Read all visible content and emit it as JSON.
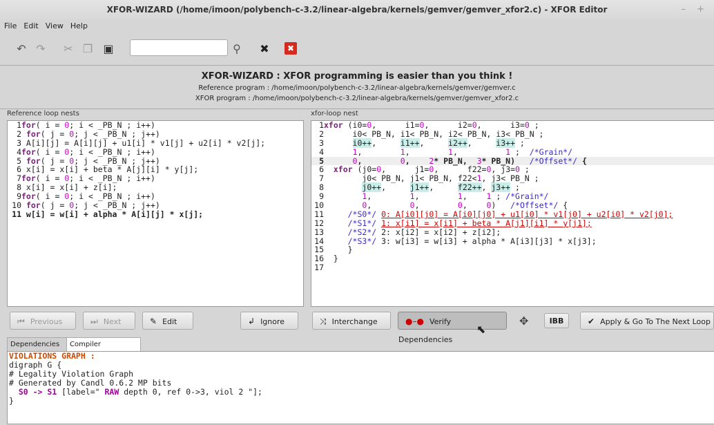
{
  "window": {
    "title": "XFOR-WIZARD (/home/imoon/polybench-c-3.2/linear-algebra/kernels/gemver/gemver_xfor2.c) - XFOR Editor",
    "controls": "– +"
  },
  "menu": [
    "File",
    "Edit",
    "View",
    "Help"
  ],
  "toolbar": {
    "undo_icon": "undo-icon",
    "redo_icon": "redo-icon",
    "cut_icon": "cut-icon",
    "copy_icon": "copy-icon",
    "paste_icon": "paste-icon",
    "search_value": "",
    "find_icon": "magnifier-icon",
    "clear_icon": "close-icon",
    "stop_icon": "stop-icon"
  },
  "banner": {
    "headline": "XFOR-WIZARD : XFOR programming is easier than you think !",
    "reference": "Reference program : /home/imoon/polybench-c-3.2/linear-algebra/kernels/gemver/gemver.c",
    "xfor": "XFOR program : /home/imoon/polybench-c-3.2/linear-algebra/kernels/gemver/gemver_xfor2.c"
  },
  "left_panel": {
    "label": "Reference loop nests",
    "lines": [
      {
        "n": "1",
        "segs": [
          {
            "t": "for",
            "c": "kw"
          },
          {
            "t": "( i = "
          },
          {
            "t": "0",
            "c": "num"
          },
          {
            "t": "; i < _PB_N ; i++)"
          }
        ]
      },
      {
        "n": "2",
        "segs": [
          {
            "t": " "
          },
          {
            "t": "for",
            "c": "kw"
          },
          {
            "t": "( j = "
          },
          {
            "t": "0",
            "c": "num"
          },
          {
            "t": "; j < _PB_N ; j++)"
          }
        ]
      },
      {
        "n": "3",
        "segs": [
          {
            "t": " A[i][j] = A[i][j] + u1[i] * v1[j] + u2[i] * v2[j];"
          }
        ]
      },
      {
        "n": "4",
        "segs": [
          {
            "t": "for",
            "c": "kw"
          },
          {
            "t": "( i = "
          },
          {
            "t": "0",
            "c": "num"
          },
          {
            "t": "; i < _PB_N ; i++)"
          }
        ]
      },
      {
        "n": "5",
        "segs": [
          {
            "t": " "
          },
          {
            "t": "for",
            "c": "kw"
          },
          {
            "t": "( j = "
          },
          {
            "t": "0",
            "c": "num"
          },
          {
            "t": "; j < _PB_N ; j++)"
          }
        ]
      },
      {
        "n": "6",
        "segs": [
          {
            "t": " x[i] = x[i] + beta * A[j][i] * y[j];"
          }
        ]
      },
      {
        "n": "7",
        "segs": [
          {
            "t": "for",
            "c": "kw"
          },
          {
            "t": "( i = "
          },
          {
            "t": "0",
            "c": "num"
          },
          {
            "t": "; i < _PB_N ; i++)"
          }
        ]
      },
      {
        "n": "8",
        "segs": [
          {
            "t": " x[i] = x[i] + z[i];"
          }
        ]
      },
      {
        "n": "9",
        "segs": [
          {
            "t": "for",
            "c": "kw"
          },
          {
            "t": "( i = "
          },
          {
            "t": "0",
            "c": "num"
          },
          {
            "t": "; i < _PB_N ; i++)"
          }
        ]
      },
      {
        "n": "10",
        "segs": [
          {
            "t": " "
          },
          {
            "t": "for",
            "c": "kw"
          },
          {
            "t": "( j = "
          },
          {
            "t": "0",
            "c": "num"
          },
          {
            "t": "; j < _PB_N ; j++)"
          }
        ]
      },
      {
        "n": "11",
        "bold": true,
        "segs": [
          {
            "t": " w[i] = w[i] + alpha * A[i][j] * x[j];"
          }
        ]
      }
    ]
  },
  "right_panel": {
    "label": "xfor-loop nest",
    "lines": [
      {
        "n": "1",
        "segs": [
          {
            "t": "xfor",
            "c": "kw"
          },
          {
            "t": " (i0="
          },
          {
            "t": "0",
            "c": "num"
          },
          {
            "t": ",      i1="
          },
          {
            "t": "0",
            "c": "num"
          },
          {
            "t": ",      i2="
          },
          {
            "t": "0",
            "c": "num"
          },
          {
            "t": ",      i3="
          },
          {
            "t": "0",
            "c": "num"
          },
          {
            "t": " ;"
          }
        ]
      },
      {
        "n": "2",
        "segs": [
          {
            "t": "      i0< PB_N, i1< PB_N, i2< PB_N, i3< PB_N ;"
          }
        ]
      },
      {
        "n": "3",
        "segs": [
          {
            "t": "      "
          },
          {
            "t": "i0++",
            "c": "hl"
          },
          {
            "t": ",     "
          },
          {
            "t": "i1++",
            "c": "hl"
          },
          {
            "t": ",     "
          },
          {
            "t": "i2++",
            "c": "hl"
          },
          {
            "t": ",     "
          },
          {
            "t": "i3++",
            "c": "hl"
          },
          {
            "t": " ;"
          }
        ]
      },
      {
        "n": "4",
        "segs": [
          {
            "t": "      "
          },
          {
            "t": "1",
            "c": "num"
          },
          {
            "t": ",        "
          },
          {
            "t": "1",
            "c": "num"
          },
          {
            "t": ",        "
          },
          {
            "t": "1",
            "c": "num"
          },
          {
            "t": ",          "
          },
          {
            "t": "1",
            "c": "num"
          },
          {
            "t": " ;  "
          },
          {
            "t": "/*Grain*/",
            "c": "cmt"
          }
        ]
      },
      {
        "n": "5",
        "bold": true,
        "cur": true,
        "segs": [
          {
            "t": "      "
          },
          {
            "t": "0",
            "c": "num"
          },
          {
            "t": ",        "
          },
          {
            "t": "0",
            "c": "num"
          },
          {
            "t": ",    "
          },
          {
            "t": "2",
            "c": "num"
          },
          {
            "t": "* PB_N,  "
          },
          {
            "t": "3",
            "c": "num"
          },
          {
            "t": "* PB_N)   "
          },
          {
            "t": "/*Offset*/",
            "c": "cmt"
          },
          {
            "t": " {"
          }
        ]
      },
      {
        "n": "6",
        "segs": [
          {
            "t": "  "
          },
          {
            "t": "xfor",
            "c": "kw"
          },
          {
            "t": " (j0="
          },
          {
            "t": "0",
            "c": "num"
          },
          {
            "t": ",      j1="
          },
          {
            "t": "0",
            "c": "num"
          },
          {
            "t": ",      f22="
          },
          {
            "t": "0",
            "c": "num"
          },
          {
            "t": ", j3="
          },
          {
            "t": "0",
            "c": "num"
          },
          {
            "t": " ;"
          }
        ]
      },
      {
        "n": "7",
        "segs": [
          {
            "t": "        j0< PB_N, j1< PB_N, f22<"
          },
          {
            "t": "1",
            "c": "num"
          },
          {
            "t": ", j3< PB_N ;"
          }
        ]
      },
      {
        "n": "8",
        "segs": [
          {
            "t": "        "
          },
          {
            "t": "j0++",
            "c": "hl"
          },
          {
            "t": ",     "
          },
          {
            "t": "j1++",
            "c": "hl"
          },
          {
            "t": ",     "
          },
          {
            "t": "f22++",
            "c": "hl"
          },
          {
            "t": ", "
          },
          {
            "t": "j3++",
            "c": "hl"
          },
          {
            "t": " ;"
          }
        ]
      },
      {
        "n": "9",
        "segs": [
          {
            "t": "        "
          },
          {
            "t": "1",
            "c": "num"
          },
          {
            "t": ",        "
          },
          {
            "t": "1",
            "c": "num"
          },
          {
            "t": ",        "
          },
          {
            "t": "1",
            "c": "num"
          },
          {
            "t": ",    "
          },
          {
            "t": "1",
            "c": "num"
          },
          {
            "t": " ; "
          },
          {
            "t": "/*Grain*/",
            "c": "cmt"
          }
        ]
      },
      {
        "n": "10",
        "segs": [
          {
            "t": "        "
          },
          {
            "t": "0",
            "c": "num"
          },
          {
            "t": ",        "
          },
          {
            "t": "0",
            "c": "num"
          },
          {
            "t": ",        "
          },
          {
            "t": "0",
            "c": "num"
          },
          {
            "t": ",    "
          },
          {
            "t": "0",
            "c": "num"
          },
          {
            "t": ")   "
          },
          {
            "t": "/*Offset*/",
            "c": "cmt"
          },
          {
            "t": " {"
          }
        ]
      },
      {
        "n": "11",
        "segs": [
          {
            "t": "     "
          },
          {
            "t": "/*S0*/",
            "c": "cmt"
          },
          {
            "t": " "
          },
          {
            "t": "0: A[i0][j0] = A[i0][j0] + u1[i0] * v1[j0] + u2[i0] * v2[j0];",
            "c": "redul"
          }
        ]
      },
      {
        "n": "12",
        "segs": [
          {
            "t": "     "
          },
          {
            "t": "/*S1*/",
            "c": "cmt"
          },
          {
            "t": " "
          },
          {
            "t": "1: x[i1] = x[i1] + beta * A[j1][i1] * y[j1];",
            "c": "redul"
          }
        ]
      },
      {
        "n": "13",
        "segs": [
          {
            "t": "     "
          },
          {
            "t": "/*S2*/",
            "c": "cmt"
          },
          {
            "t": " 2: x[i2] = x[i2] + z[i2];"
          }
        ]
      },
      {
        "n": "14",
        "segs": [
          {
            "t": "     "
          },
          {
            "t": "/*S3*/",
            "c": "cmt"
          },
          {
            "t": " 3: w[i3] = w[i3] + alpha * A[i3][j3] * x[j3];"
          }
        ]
      },
      {
        "n": "15",
        "segs": [
          {
            "t": "     }"
          }
        ]
      },
      {
        "n": "16",
        "segs": [
          {
            "t": "  }"
          }
        ]
      },
      {
        "n": "17",
        "segs": [
          {
            "t": ""
          }
        ]
      }
    ]
  },
  "buttons": {
    "previous": "Previous",
    "next": "Next",
    "edit": "Edit",
    "ignore": "Ignore",
    "interchange": "Interchange",
    "verify": "Verify Dependencies",
    "ibb": "IBB",
    "apply": "Apply & Go To The Next Loop"
  },
  "tabs": [
    "Dependencies",
    "Compiler messages"
  ],
  "console": {
    "l1": "VIOLATIONS GRAPH :",
    "l2": "digraph G {",
    "l3": "# Legality Violation Graph",
    "l4": "# Generated by Candl 0.6.2 MP bits",
    "l5a": "S0 -> S1",
    "l5b": " [label=\"",
    "l5c": " RAW",
    "l5d": " depth 0, ref 0->3, viol 2 \"];",
    "l6": "}"
  }
}
